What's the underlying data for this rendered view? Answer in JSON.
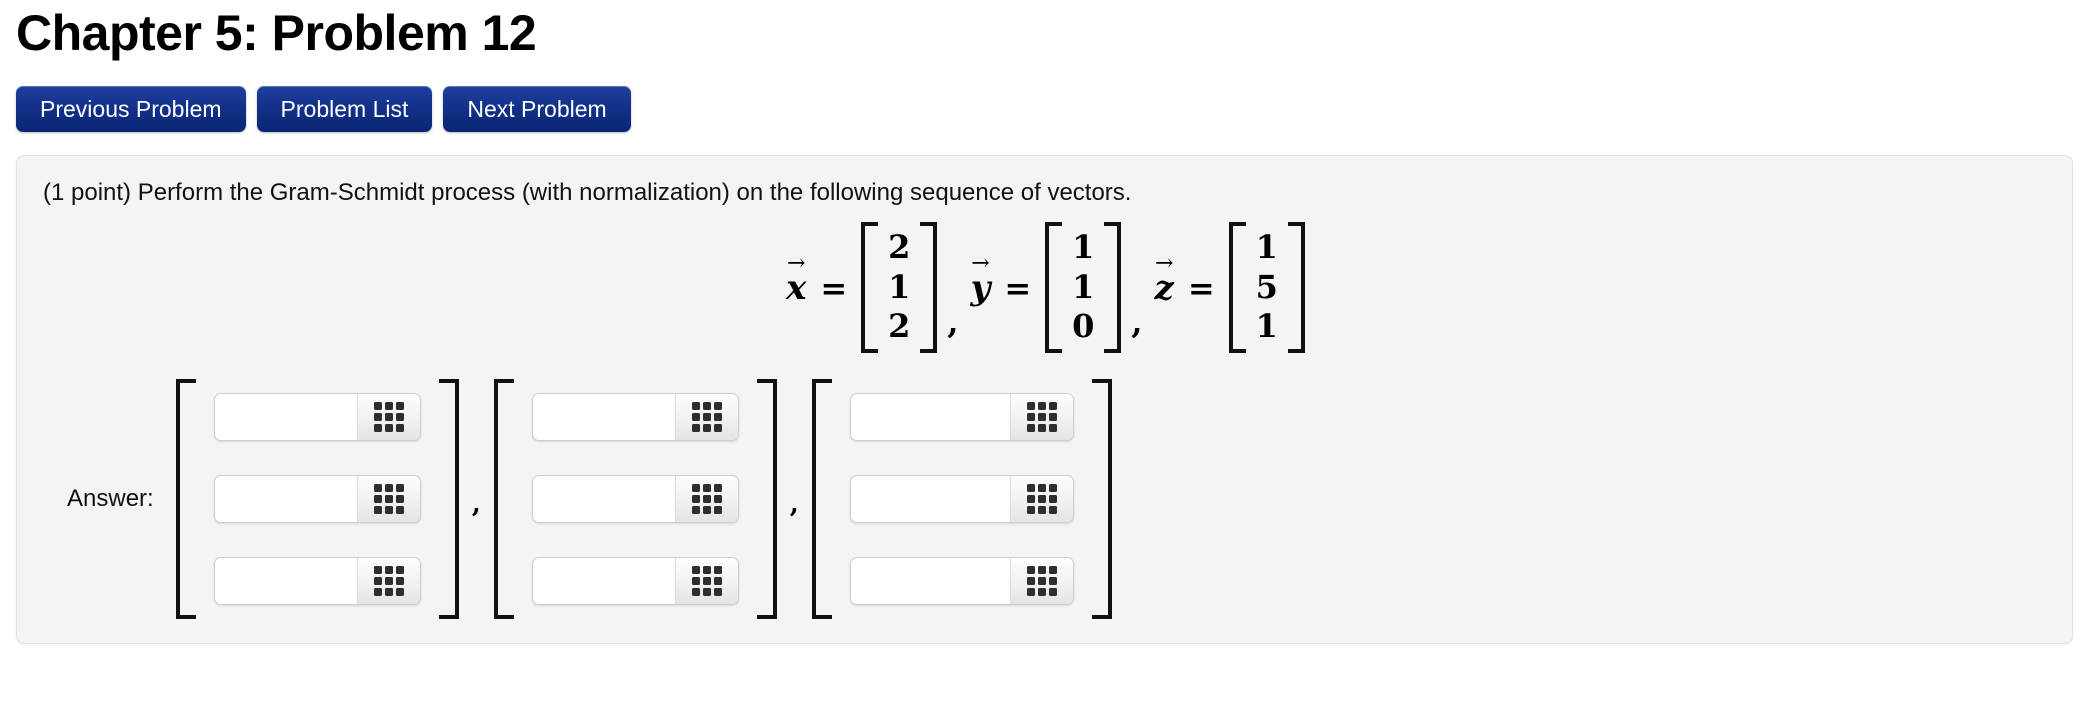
{
  "header": {
    "title": "Chapter 5: Problem 12"
  },
  "nav": {
    "buttons": [
      {
        "label": "Previous Problem",
        "name": "previous-problem-button"
      },
      {
        "label": "Problem List",
        "name": "problem-list-button"
      },
      {
        "label": "Next Problem",
        "name": "next-problem-button"
      }
    ]
  },
  "problem": {
    "statement": "(1 point) Perform the Gram-Schmidt process (with normalization) on the following sequence of vectors.",
    "vectors": [
      {
        "name": "x",
        "arrow": "⃗",
        "equals": "=",
        "entries": [
          "2",
          "1",
          "2"
        ]
      },
      {
        "name": "y",
        "arrow": "⃗",
        "equals": "=",
        "entries": [
          "1",
          "1",
          "0"
        ]
      },
      {
        "name": "z",
        "arrow": "⃗",
        "equals": "=",
        "entries": [
          "1",
          "5",
          "1"
        ]
      }
    ],
    "separator": ","
  },
  "answer": {
    "label": "Answer:",
    "separator": ",",
    "bracket_open": "[",
    "bracket_close": "]",
    "groups": [
      {
        "fields": [
          {
            "value": "",
            "placeholder": ""
          },
          {
            "value": "",
            "placeholder": ""
          },
          {
            "value": "",
            "placeholder": ""
          }
        ]
      },
      {
        "fields": [
          {
            "value": "",
            "placeholder": ""
          },
          {
            "value": "",
            "placeholder": ""
          },
          {
            "value": "",
            "placeholder": ""
          }
        ]
      },
      {
        "fields": [
          {
            "value": "",
            "placeholder": ""
          },
          {
            "value": "",
            "placeholder": ""
          },
          {
            "value": "",
            "placeholder": ""
          }
        ]
      }
    ],
    "keypad_icon": "math-keypad-icon"
  },
  "colors": {
    "button_blue_top": "#1f40a0",
    "button_blue_bottom": "#0a2573",
    "panel_background": "#f4f4f4",
    "panel_border": "#e2e2e2"
  }
}
